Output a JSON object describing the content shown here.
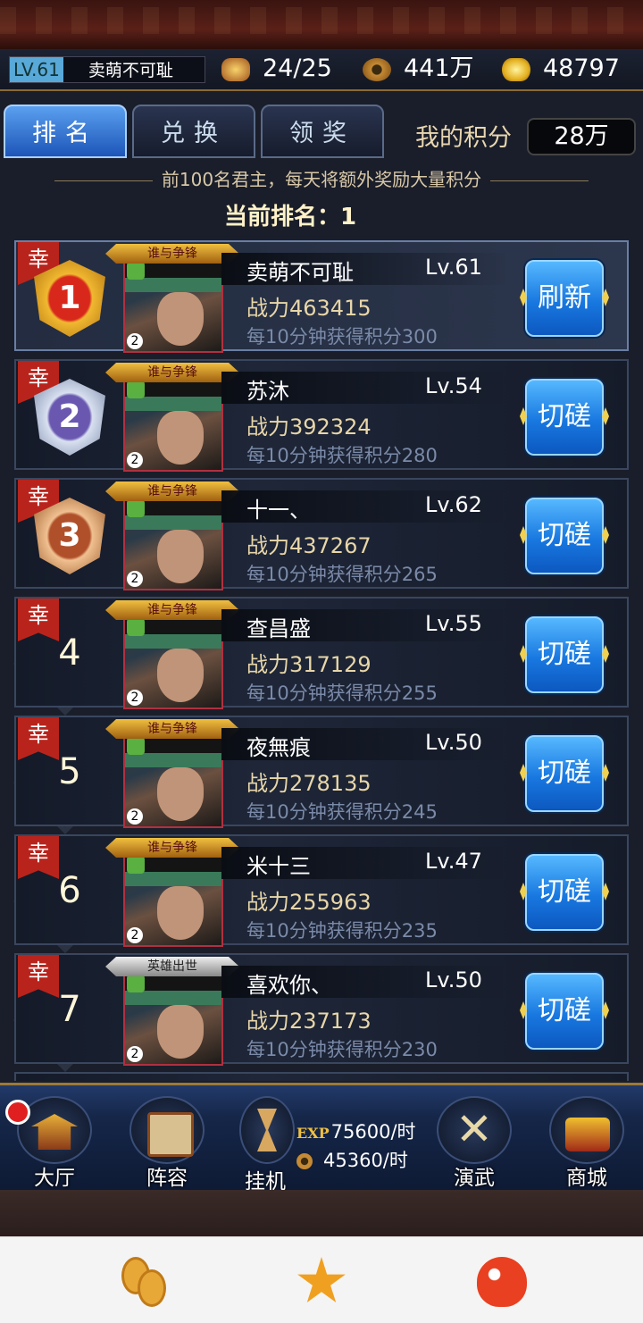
{
  "header": {
    "level": "LV.61",
    "player_name": "卖萌不可耻",
    "stamina": "24/25",
    "copper": "441万",
    "gold": "48797"
  },
  "tabs": [
    {
      "label": "排名",
      "active": true
    },
    {
      "label": "兑换",
      "active": false
    },
    {
      "label": "领奖",
      "active": false
    }
  ],
  "my_score": {
    "label": "我的积分",
    "value": "28万"
  },
  "notice": "前100名君主，每天将额外奖励大量积分",
  "current_rank": "当前排名：1",
  "luck_char": "幸",
  "ranking": [
    {
      "rank": "1",
      "medal": "gold",
      "name": "卖萌不可耻",
      "level": "Lv.61",
      "power": "战力463415",
      "points": "每10分钟获得积分300",
      "button": "刷新",
      "title": "谁与争锋"
    },
    {
      "rank": "2",
      "medal": "silver",
      "name": "苏沐",
      "level": "Lv.54",
      "power": "战力392324",
      "points": "每10分钟获得积分280",
      "button": "切磋",
      "title": "谁与争锋"
    },
    {
      "rank": "3",
      "medal": "bronze",
      "name": "十一、",
      "level": "Lv.62",
      "power": "战力437267",
      "points": "每10分钟获得积分265",
      "button": "切磋",
      "title": "谁与争锋"
    },
    {
      "rank": "4",
      "medal": "",
      "name": "查昌盛",
      "level": "Lv.55",
      "power": "战力317129",
      "points": "每10分钟获得积分255",
      "button": "切磋",
      "title": "谁与争锋"
    },
    {
      "rank": "5",
      "medal": "",
      "name": "夜無痕",
      "level": "Lv.50",
      "power": "战力278135",
      "points": "每10分钟获得积分245",
      "button": "切磋",
      "title": "谁与争锋"
    },
    {
      "rank": "6",
      "medal": "",
      "name": "米十三",
      "level": "Lv.47",
      "power": "战力255963",
      "points": "每10分钟获得积分235",
      "button": "切磋",
      "title": "谁与争锋"
    },
    {
      "rank": "7",
      "medal": "",
      "name": "喜欢你、",
      "level": "Lv.50",
      "power": "战力237173",
      "points": "每10分钟获得积分230",
      "button": "切磋",
      "title": "英雄出世"
    }
  ],
  "bottom_nav": {
    "hall": "大厅",
    "lineup": "阵容",
    "idle": "挂机",
    "idle_exp_tag": "EXP",
    "idle_exp": "75600/时",
    "idle_coin": "45360/时",
    "martial": "演武",
    "shop": "商城"
  },
  "system_icons": [
    "coins-icon",
    "star-icon",
    "bird-icon"
  ]
}
